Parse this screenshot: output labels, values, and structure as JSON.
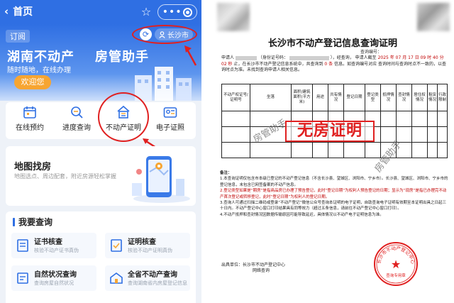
{
  "app": {
    "header": {
      "back_label": "首页"
    },
    "banner": {
      "subscribe_tag": "订阅",
      "city": "长沙市",
      "title_left": "湖南不动产",
      "title_right": "房管助手",
      "slogan": "随时随地，在线办理",
      "welcome_button": "欢迎您"
    },
    "quick": [
      {
        "label": "在线预约",
        "icon": "calendar-icon"
      },
      {
        "label": "进度查询",
        "icon": "progress-search-icon"
      },
      {
        "label": "不动产证明",
        "icon": "house-cert-icon"
      },
      {
        "label": "电子证照",
        "icon": "id-card-icon"
      }
    ],
    "map": {
      "title": "地图找房",
      "desc": "地图选点、周边配套，附近房源轻松掌握"
    },
    "query": {
      "heading": "我要查询",
      "items": [
        {
          "title": "证书核查",
          "sub": "核验不动产证书真伪",
          "icon": "certificate-icon"
        },
        {
          "title": "证明核查",
          "sub": "核验不动产证明真伪",
          "icon": "document-check-icon"
        },
        {
          "title": "自然状况查询",
          "sub": "查询房屋自然状况",
          "icon": "house-info-icon"
        },
        {
          "title": "全省不动产查询",
          "sub": "查询湖南省内房屋登记信息",
          "icon": "province-search-icon"
        }
      ]
    }
  },
  "doc": {
    "title": "长沙市不动产登记信息查询证明",
    "query_no_label": "查询编号：",
    "para": {
      "line1_a": "申请人",
      "line1_b": "（身份证号码：",
      "line1_c": "），经查询，",
      "line1_d": "申请人截至",
      "line1_date": "2025 年 07",
      "line2_a": "月 17 日 09 时 40 分 02 秒",
      "line2_b": "止，在长沙市不动产登记信息系统中，共查询到",
      "line2_c": "0 条",
      "line2_d": "信息。如查询编号对应",
      "line3": "查询时间与查询时点不一致的，以查询时点为准。未找到查询申请人相关信息。"
    },
    "table_headers": [
      "不动产权证号/证明号",
      "坐落",
      "面积/建筑面积(平方米)",
      "用途",
      "共有情况",
      "登记日期",
      "登记类型",
      "抵押情况",
      "查封情况",
      "居住权情况",
      "租赁情况",
      "行政限制"
    ],
    "stamp_text": "无房证明",
    "watermark": "房管助手",
    "notes": {
      "heading": "备注：",
      "n1": "1.本查询证明仅包含市本级已登记的不动产登记信息（不含长沙县、望城区、浏阳市、宁乡市）。长沙县、望城区、浏阳市、宁乡市的登记信息，未包含已网签备案的不动产信息。",
      "n2a": "2.登记类型如果是“期房”是指商品房已办理了预告登记，此时“登记日期”为权利人预告登记的日期；显示为“现房”是指已办理完不动产首次登记或转移登记，此时“登记日期”为权利人的登记日期。",
      "n3": "3.查询人可通过扫描二维码或登录“不动产登记”微信公众号查询本证明的电子证明，自助查询电子证明有效期至本证明出具之日起三十日内。不动产登记中心窗口打印结果具有同等效力（超过五条信息，请前往不动产登记中心窗口打印）。",
      "n4": "4.不动产抵押和查封情况因数据传输原因可能导致延迟，具体情况以不动产电子证明信息为准。"
    },
    "footer": {
      "label": "出具单位：",
      "org": "长沙市不动产登记中心",
      "sub": "网络查询"
    },
    "seal": {
      "ring_text": "长沙市不动产登记中心",
      "center_text": "★",
      "bottom_text": "查询专用章"
    }
  },
  "colors": {
    "primary": "#2f6fe3",
    "accent_orange": "#f7a531",
    "annotation_red": "#e02020"
  }
}
